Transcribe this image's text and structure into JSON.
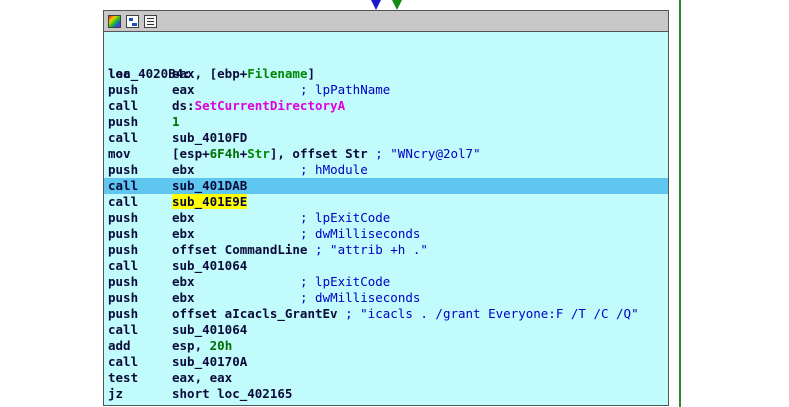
{
  "toolbar": {
    "icons": [
      "color-palette-icon",
      "graph-overview-icon",
      "text-view-icon"
    ]
  },
  "colors": {
    "node_background": "#c1fbfb",
    "selected_line": "#5fc6f0",
    "highlight": "#ffff00",
    "function_name": "#e000e0",
    "comment": "#0000c8",
    "true_branch_arrow": "#138a13",
    "false_branch_arrow": "#1a1acc"
  },
  "label": "loc_4020B4:",
  "lines": [
    {
      "mn": "lea",
      "op_pre": "eax, [ebp+",
      "op_var": "Filename",
      "op_post": "]"
    },
    {
      "mn": "push",
      "op": "eax",
      "comment": "; lpPathName"
    },
    {
      "mn": "call",
      "op_pre": "ds:",
      "op_fn": "SetCurrentDirectoryA"
    },
    {
      "mn": "push",
      "op_num": "1"
    },
    {
      "mn": "call",
      "op": "sub_4010FD"
    },
    {
      "mn": "mov",
      "op_pre": "[esp+",
      "op_num": "6F4h",
      "op_mid": "+",
      "op_var": "Str",
      "op_post": "], offset Str",
      "comment": "; \"WNcry@2ol7\""
    },
    {
      "mn": "push",
      "op": "ebx",
      "comment": "; hModule"
    },
    {
      "mn": "call",
      "op": "sub_401DAB",
      "selected": true
    },
    {
      "mn": "call",
      "op_hl": "sub_401E9E"
    },
    {
      "mn": "push",
      "op": "ebx",
      "comment": "; lpExitCode"
    },
    {
      "mn": "push",
      "op": "ebx",
      "comment": "; dwMilliseconds"
    },
    {
      "mn": "push",
      "op": "offset CommandLine",
      "comment": "; \"attrib +h .\""
    },
    {
      "mn": "call",
      "op": "sub_401064"
    },
    {
      "mn": "push",
      "op": "ebx",
      "comment": "; lpExitCode"
    },
    {
      "mn": "push",
      "op": "ebx",
      "comment": "; dwMilliseconds"
    },
    {
      "mn": "push",
      "op": "offset aIcacls_GrantEv",
      "comment": "; \"icacls . /grant Everyone:F /T /C /Q\""
    },
    {
      "mn": "call",
      "op": "sub_401064"
    },
    {
      "mn": "add",
      "op_pre": "esp, ",
      "op_num": "20h"
    },
    {
      "mn": "call",
      "op": "sub_40170A"
    },
    {
      "mn": "test",
      "op": "eax, eax"
    },
    {
      "mn": "jz",
      "op": "short loc_402165"
    }
  ]
}
